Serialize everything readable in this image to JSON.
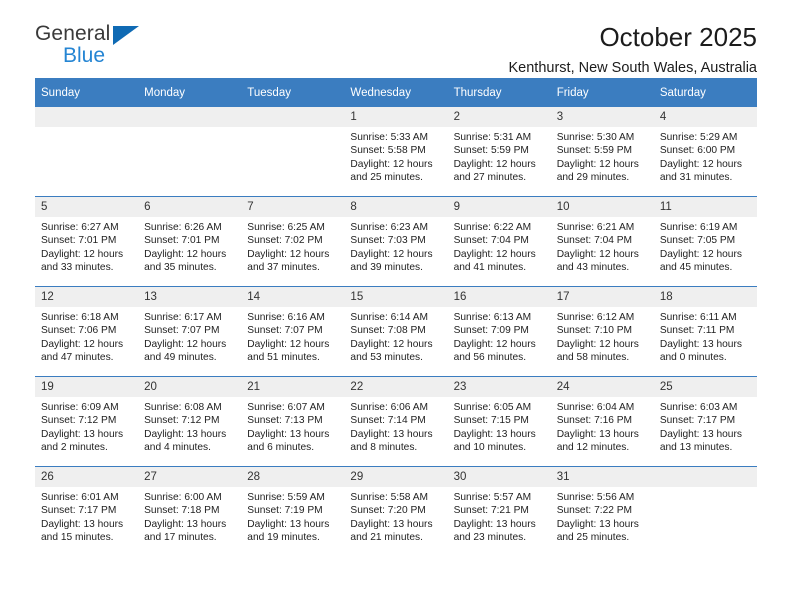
{
  "brand": {
    "name_top": "General",
    "name_bottom": "Blue",
    "accent_color": "#0f6ab4",
    "blue_text_color": "#2585d3"
  },
  "header": {
    "title": "October 2025",
    "subtitle": "Kenthurst, New South Wales, Australia"
  },
  "calendar": {
    "header_bg": "#3b7dc0",
    "daynum_bg": "#efefef",
    "weekdays": [
      "Sunday",
      "Monday",
      "Tuesday",
      "Wednesday",
      "Thursday",
      "Friday",
      "Saturday"
    ],
    "labels": {
      "sunrise": "Sunrise:",
      "sunset": "Sunset:",
      "daylight": "Daylight:"
    },
    "weeks": [
      [
        {
          "day": "",
          "sunrise": "",
          "sunset": "",
          "daylight": "",
          "empty": true
        },
        {
          "day": "",
          "sunrise": "",
          "sunset": "",
          "daylight": "",
          "empty": true
        },
        {
          "day": "",
          "sunrise": "",
          "sunset": "",
          "daylight": "",
          "empty": true
        },
        {
          "day": "1",
          "sunrise": "Sunrise: 5:33 AM",
          "sunset": "Sunset: 5:58 PM",
          "daylight": "Daylight: 12 hours and 25 minutes."
        },
        {
          "day": "2",
          "sunrise": "Sunrise: 5:31 AM",
          "sunset": "Sunset: 5:59 PM",
          "daylight": "Daylight: 12 hours and 27 minutes."
        },
        {
          "day": "3",
          "sunrise": "Sunrise: 5:30 AM",
          "sunset": "Sunset: 5:59 PM",
          "daylight": "Daylight: 12 hours and 29 minutes."
        },
        {
          "day": "4",
          "sunrise": "Sunrise: 5:29 AM",
          "sunset": "Sunset: 6:00 PM",
          "daylight": "Daylight: 12 hours and 31 minutes."
        }
      ],
      [
        {
          "day": "5",
          "sunrise": "Sunrise: 6:27 AM",
          "sunset": "Sunset: 7:01 PM",
          "daylight": "Daylight: 12 hours and 33 minutes."
        },
        {
          "day": "6",
          "sunrise": "Sunrise: 6:26 AM",
          "sunset": "Sunset: 7:01 PM",
          "daylight": "Daylight: 12 hours and 35 minutes."
        },
        {
          "day": "7",
          "sunrise": "Sunrise: 6:25 AM",
          "sunset": "Sunset: 7:02 PM",
          "daylight": "Daylight: 12 hours and 37 minutes."
        },
        {
          "day": "8",
          "sunrise": "Sunrise: 6:23 AM",
          "sunset": "Sunset: 7:03 PM",
          "daylight": "Daylight: 12 hours and 39 minutes."
        },
        {
          "day": "9",
          "sunrise": "Sunrise: 6:22 AM",
          "sunset": "Sunset: 7:04 PM",
          "daylight": "Daylight: 12 hours and 41 minutes."
        },
        {
          "day": "10",
          "sunrise": "Sunrise: 6:21 AM",
          "sunset": "Sunset: 7:04 PM",
          "daylight": "Daylight: 12 hours and 43 minutes."
        },
        {
          "day": "11",
          "sunrise": "Sunrise: 6:19 AM",
          "sunset": "Sunset: 7:05 PM",
          "daylight": "Daylight: 12 hours and 45 minutes."
        }
      ],
      [
        {
          "day": "12",
          "sunrise": "Sunrise: 6:18 AM",
          "sunset": "Sunset: 7:06 PM",
          "daylight": "Daylight: 12 hours and 47 minutes."
        },
        {
          "day": "13",
          "sunrise": "Sunrise: 6:17 AM",
          "sunset": "Sunset: 7:07 PM",
          "daylight": "Daylight: 12 hours and 49 minutes."
        },
        {
          "day": "14",
          "sunrise": "Sunrise: 6:16 AM",
          "sunset": "Sunset: 7:07 PM",
          "daylight": "Daylight: 12 hours and 51 minutes."
        },
        {
          "day": "15",
          "sunrise": "Sunrise: 6:14 AM",
          "sunset": "Sunset: 7:08 PM",
          "daylight": "Daylight: 12 hours and 53 minutes."
        },
        {
          "day": "16",
          "sunrise": "Sunrise: 6:13 AM",
          "sunset": "Sunset: 7:09 PM",
          "daylight": "Daylight: 12 hours and 56 minutes."
        },
        {
          "day": "17",
          "sunrise": "Sunrise: 6:12 AM",
          "sunset": "Sunset: 7:10 PM",
          "daylight": "Daylight: 12 hours and 58 minutes."
        },
        {
          "day": "18",
          "sunrise": "Sunrise: 6:11 AM",
          "sunset": "Sunset: 7:11 PM",
          "daylight": "Daylight: 13 hours and 0 minutes."
        }
      ],
      [
        {
          "day": "19",
          "sunrise": "Sunrise: 6:09 AM",
          "sunset": "Sunset: 7:12 PM",
          "daylight": "Daylight: 13 hours and 2 minutes."
        },
        {
          "day": "20",
          "sunrise": "Sunrise: 6:08 AM",
          "sunset": "Sunset: 7:12 PM",
          "daylight": "Daylight: 13 hours and 4 minutes."
        },
        {
          "day": "21",
          "sunrise": "Sunrise: 6:07 AM",
          "sunset": "Sunset: 7:13 PM",
          "daylight": "Daylight: 13 hours and 6 minutes."
        },
        {
          "day": "22",
          "sunrise": "Sunrise: 6:06 AM",
          "sunset": "Sunset: 7:14 PM",
          "daylight": "Daylight: 13 hours and 8 minutes."
        },
        {
          "day": "23",
          "sunrise": "Sunrise: 6:05 AM",
          "sunset": "Sunset: 7:15 PM",
          "daylight": "Daylight: 13 hours and 10 minutes."
        },
        {
          "day": "24",
          "sunrise": "Sunrise: 6:04 AM",
          "sunset": "Sunset: 7:16 PM",
          "daylight": "Daylight: 13 hours and 12 minutes."
        },
        {
          "day": "25",
          "sunrise": "Sunrise: 6:03 AM",
          "sunset": "Sunset: 7:17 PM",
          "daylight": "Daylight: 13 hours and 13 minutes."
        }
      ],
      [
        {
          "day": "26",
          "sunrise": "Sunrise: 6:01 AM",
          "sunset": "Sunset: 7:17 PM",
          "daylight": "Daylight: 13 hours and 15 minutes."
        },
        {
          "day": "27",
          "sunrise": "Sunrise: 6:00 AM",
          "sunset": "Sunset: 7:18 PM",
          "daylight": "Daylight: 13 hours and 17 minutes."
        },
        {
          "day": "28",
          "sunrise": "Sunrise: 5:59 AM",
          "sunset": "Sunset: 7:19 PM",
          "daylight": "Daylight: 13 hours and 19 minutes."
        },
        {
          "day": "29",
          "sunrise": "Sunrise: 5:58 AM",
          "sunset": "Sunset: 7:20 PM",
          "daylight": "Daylight: 13 hours and 21 minutes."
        },
        {
          "day": "30",
          "sunrise": "Sunrise: 5:57 AM",
          "sunset": "Sunset: 7:21 PM",
          "daylight": "Daylight: 13 hours and 23 minutes."
        },
        {
          "day": "31",
          "sunrise": "Sunrise: 5:56 AM",
          "sunset": "Sunset: 7:22 PM",
          "daylight": "Daylight: 13 hours and 25 minutes."
        },
        {
          "day": "",
          "sunrise": "",
          "sunset": "",
          "daylight": "",
          "empty": true
        }
      ]
    ]
  }
}
